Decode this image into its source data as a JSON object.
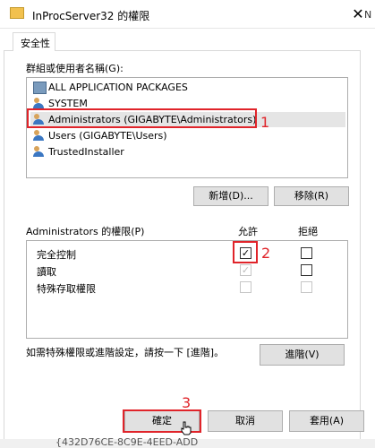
{
  "window": {
    "title": "InProcServer32 的權限",
    "close_glyph": "✕",
    "tab_label": "安全性"
  },
  "groups": {
    "label": "群組或使用者名稱(G):",
    "items": [
      {
        "label": "ALL APPLICATION PACKAGES",
        "icon": "package-icon"
      },
      {
        "label": "SYSTEM",
        "icon": "users-icon"
      },
      {
        "label": "Administrators (GIGABYTE\\Administrators)",
        "icon": "users-icon"
      },
      {
        "label": "Users (GIGABYTE\\Users)",
        "icon": "users-icon"
      },
      {
        "label": "TrustedInstaller",
        "icon": "users-icon"
      }
    ],
    "add_label": "新增(D)...",
    "remove_label": "移除(R)"
  },
  "permissions": {
    "label": "Administrators 的權限(P)",
    "allow_header": "允許",
    "deny_header": "拒絕",
    "rows": [
      {
        "name": "完全控制",
        "allow": "checked",
        "deny": "unchecked"
      },
      {
        "name": "讀取",
        "allow": "checked-disabled",
        "deny": "unchecked"
      },
      {
        "name": "特殊存取權限",
        "allow": "disabled",
        "deny": "disabled"
      }
    ]
  },
  "advanced": {
    "text": "如需特殊權限或進階設定，請按一下 [進階]。",
    "button_label": "進階(V)"
  },
  "footer": {
    "ok_label": "確定",
    "cancel_label": "取消",
    "apply_label": "套用(A)"
  },
  "annotations": {
    "step1": "1",
    "step2": "2",
    "step3": "3"
  },
  "background": {
    "tree_text": "{432D76CE-8C9E-4EED-ADD"
  },
  "colors": {
    "annotation_red": "#e0242a",
    "selection_gray": "#e5e5e5"
  }
}
